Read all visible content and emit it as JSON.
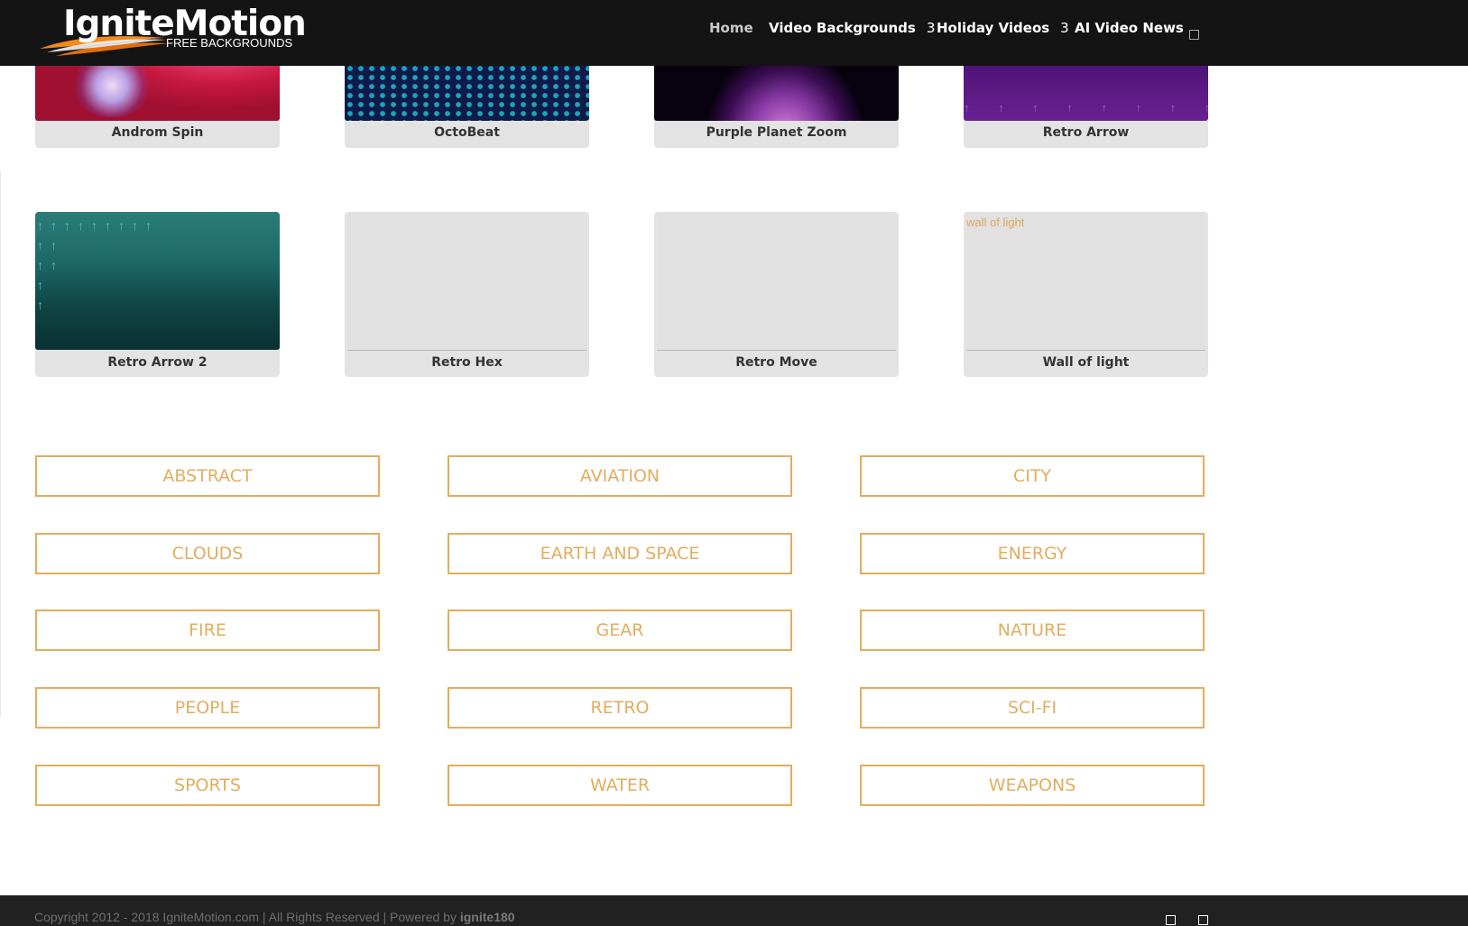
{
  "header": {
    "logo": {
      "brand": "IgniteMotion",
      "tagline": "FREE BACKGROUNDS",
      "accent": "#f28a1a"
    },
    "nav": [
      {
        "label": "Home",
        "has_submenu": false,
        "active": true
      },
      {
        "label": "Video Backgrounds",
        "has_submenu": true,
        "arrow": "3"
      },
      {
        "label": "Holiday Videos",
        "has_submenu": true,
        "arrow": "3"
      },
      {
        "label": "AI Video News",
        "has_submenu": false
      }
    ],
    "search_icon": "search-icon"
  },
  "videos": {
    "row1": [
      {
        "title": "Androm Spin",
        "thumb": "red-purple-swirl"
      },
      {
        "title": "OctoBeat",
        "thumb": "blue-hex-grid"
      },
      {
        "title": "Purple Planet Zoom",
        "thumb": "purple-planet"
      },
      {
        "title": "Retro Arrow",
        "thumb": "purple-arrows"
      }
    ],
    "row2": [
      {
        "title": "Retro Arrow 2",
        "thumb": "teal-arrows"
      },
      {
        "title": "Retro Hex",
        "thumb": ""
      },
      {
        "title": "Retro Move",
        "thumb": ""
      },
      {
        "title": "Wall of light",
        "thumb": "",
        "alt": "wall of light"
      }
    ]
  },
  "categories": [
    "ABSTRACT",
    "AVIATION",
    "CITY",
    "CLOUDS",
    "EARTH AND SPACE",
    "ENERGY",
    "FIRE",
    "GEAR",
    "NATURE",
    "PEOPLE",
    "RETRO",
    "SCI-FI",
    "SPORTS",
    "WATER",
    "WEAPONS"
  ],
  "footer": {
    "copyright": "Copyright 2012 - 2018 IgniteMotion.com | All Rights Reserved | Powered by",
    "powered_by": "ignite180",
    "social_icons": [
      "social-icon-1",
      "social-icon-2"
    ]
  },
  "colors": {
    "accent": "#e2ad5e",
    "header_bg": "#141414",
    "footer_bg": "#212121"
  }
}
